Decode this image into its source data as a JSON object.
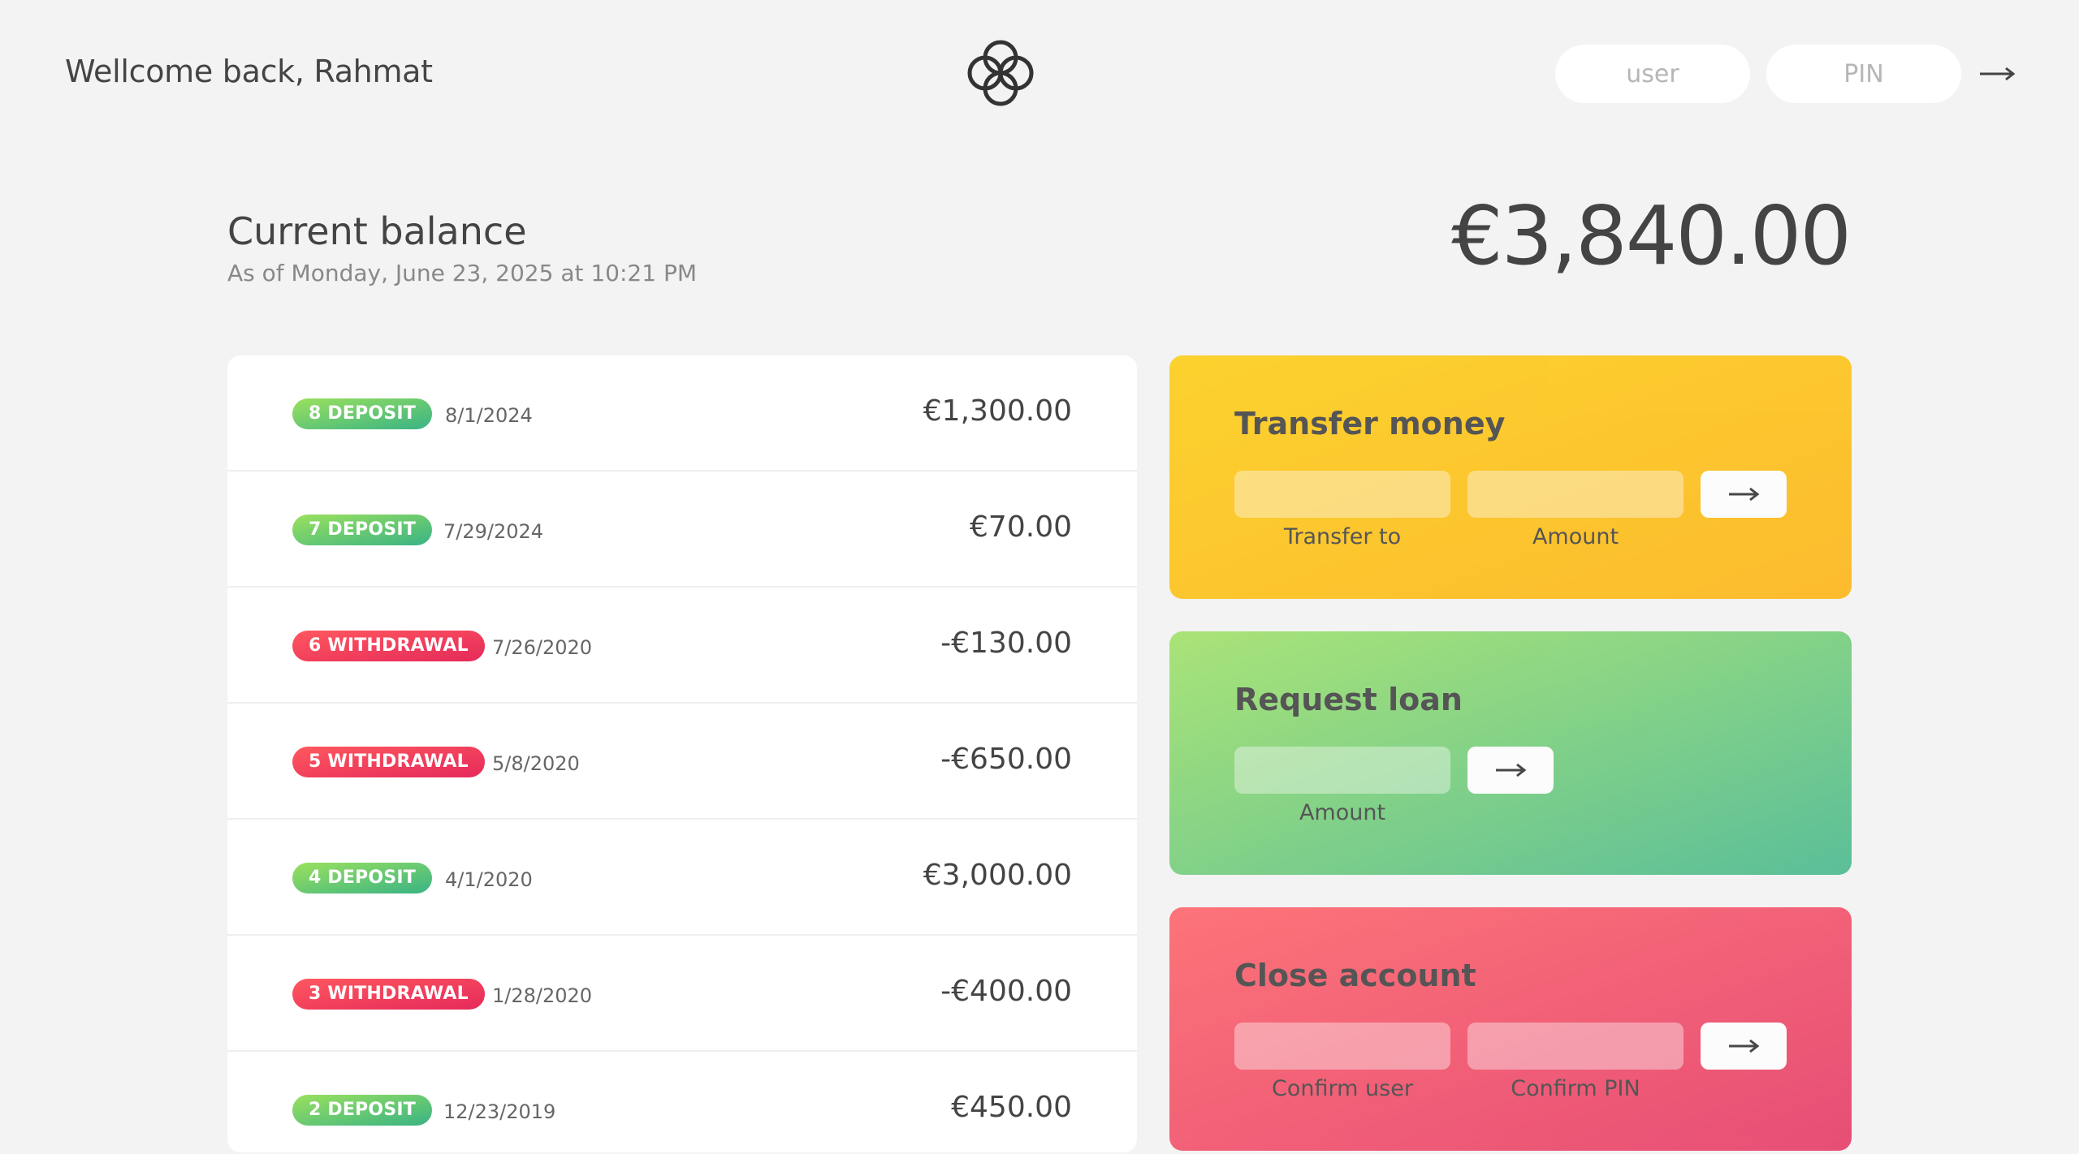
{
  "nav": {
    "welcome": "Wellcome back, Rahmat",
    "logo_icon": "four-circles-logo-icon",
    "login_user_placeholder": "user",
    "login_pin_placeholder": "PIN",
    "login_button_icon": "arrow-right-icon"
  },
  "balance": {
    "label": "Current balance",
    "date": "As of Monday, June 23, 2025 at 10:21 PM",
    "value": "€3,840.00"
  },
  "movements": [
    {
      "type_label": "8 DEPOSIT",
      "kind": "deposit",
      "date": "8/1/2024",
      "value": "€1,300.00"
    },
    {
      "type_label": "7 DEPOSIT",
      "kind": "deposit",
      "date": "7/29/2024",
      "value": "€70.00"
    },
    {
      "type_label": "6 WITHDRAWAL",
      "kind": "withdrawal",
      "date": "7/26/2020",
      "value": "-€130.00"
    },
    {
      "type_label": "5 WITHDRAWAL",
      "kind": "withdrawal",
      "date": "5/8/2020",
      "value": "-€650.00"
    },
    {
      "type_label": "4 DEPOSIT",
      "kind": "deposit",
      "date": "4/1/2020",
      "value": "€3,000.00"
    },
    {
      "type_label": "3 WITHDRAWAL",
      "kind": "withdrawal",
      "date": "1/28/2020",
      "value": "-€400.00"
    },
    {
      "type_label": "2 DEPOSIT",
      "kind": "deposit",
      "date": "12/23/2019",
      "value": "€450.00"
    }
  ],
  "operations": {
    "transfer": {
      "title": "Transfer money",
      "label_to": "Transfer to",
      "label_amount": "Amount"
    },
    "loan": {
      "title": "Request loan",
      "label_amount": "Amount"
    },
    "close": {
      "title": "Close account",
      "label_user": "Confirm user",
      "label_pin": "Confirm PIN"
    }
  },
  "colors": {
    "deposit": "#39b385",
    "withdrawal": "#e52a5a",
    "transfer": "#ffb003",
    "background": "#f3f3f3"
  }
}
